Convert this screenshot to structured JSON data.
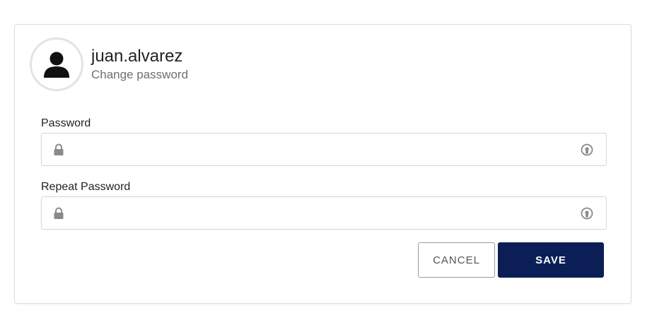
{
  "profile": {
    "username": "juan.alvarez",
    "subtitle": "Change password",
    "avatar_icon": "user-silhouette-icon"
  },
  "form": {
    "password": {
      "label": "Password",
      "value": "",
      "placeholder": "",
      "leading_icon": "lock-icon",
      "trailing_icon": "reveal-password-icon"
    },
    "repeat_password": {
      "label": "Repeat Password",
      "value": "",
      "placeholder": "",
      "leading_icon": "lock-icon",
      "trailing_icon": "reveal-password-icon"
    }
  },
  "actions": {
    "cancel_label": "CANCEL",
    "save_label": "SAVE"
  },
  "colors": {
    "primary": "#0b1f56",
    "border": "#d6d6d6",
    "icon_gray": "#8a8a8a",
    "subtitle_text": "#6f6f6f"
  }
}
